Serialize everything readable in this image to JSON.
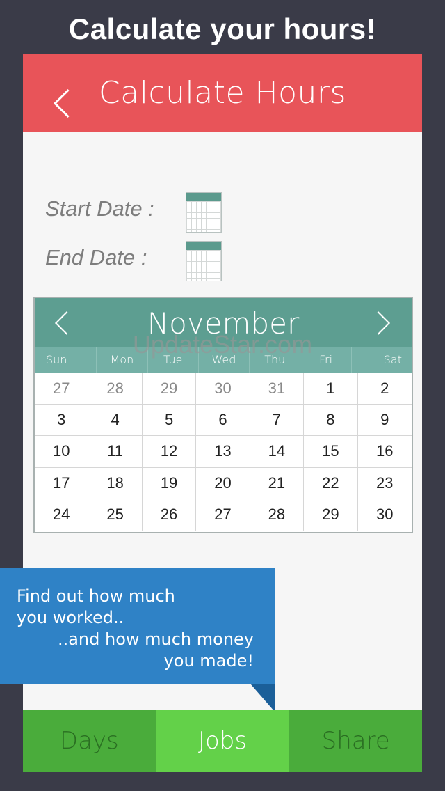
{
  "headline": "Calculate your hours!",
  "topbar": {
    "title": "Calculate Hours"
  },
  "dates": {
    "start_label": "Start Date :",
    "end_label": "End Date :"
  },
  "calendar": {
    "month": "November",
    "weekdays": [
      "Sun",
      "Mon",
      "Tue",
      "Wed",
      "Thu",
      "Fri",
      "Sat"
    ],
    "days": [
      {
        "d": "27",
        "muted": true
      },
      {
        "d": "28",
        "muted": true
      },
      {
        "d": "29",
        "muted": true
      },
      {
        "d": "30",
        "muted": true
      },
      {
        "d": "31",
        "muted": true
      },
      {
        "d": "1",
        "muted": false
      },
      {
        "d": "2",
        "muted": false
      },
      {
        "d": "3",
        "muted": false
      },
      {
        "d": "4",
        "muted": false
      },
      {
        "d": "5",
        "muted": false
      },
      {
        "d": "6",
        "muted": false
      },
      {
        "d": "7",
        "muted": false
      },
      {
        "d": "8",
        "muted": false
      },
      {
        "d": "9",
        "muted": false
      },
      {
        "d": "10",
        "muted": false
      },
      {
        "d": "11",
        "muted": false
      },
      {
        "d": "12",
        "muted": false
      },
      {
        "d": "13",
        "muted": false
      },
      {
        "d": "14",
        "muted": false
      },
      {
        "d": "15",
        "muted": false
      },
      {
        "d": "16",
        "muted": false
      },
      {
        "d": "17",
        "muted": false
      },
      {
        "d": "18",
        "muted": false
      },
      {
        "d": "19",
        "muted": false
      },
      {
        "d": "20",
        "muted": false
      },
      {
        "d": "21",
        "muted": false
      },
      {
        "d": "22",
        "muted": false
      },
      {
        "d": "23",
        "muted": false
      },
      {
        "d": "24",
        "muted": false
      },
      {
        "d": "25",
        "muted": false
      },
      {
        "d": "26",
        "muted": false
      },
      {
        "d": "27",
        "muted": false
      },
      {
        "d": "28",
        "muted": false
      },
      {
        "d": "29",
        "muted": false
      },
      {
        "d": "30",
        "muted": false
      }
    ]
  },
  "watermark": "UpdateStar.com",
  "banner": {
    "line1": "Find out how much",
    "line2": "you worked..",
    "line3": "..and how much money",
    "line4": "you made!"
  },
  "tabs": {
    "days": "Days",
    "jobs": "Jobs",
    "share": "Share"
  },
  "colors": {
    "topbar": "#e85459",
    "calendar_header": "#5d9e91",
    "banner": "#2f82c6",
    "tab_active": "#63d149",
    "tab_inactive": "#4aac3b"
  },
  "icons": [
    "back-chevron-icon",
    "calendar-icon",
    "chevron-left-icon",
    "chevron-right-icon"
  ]
}
